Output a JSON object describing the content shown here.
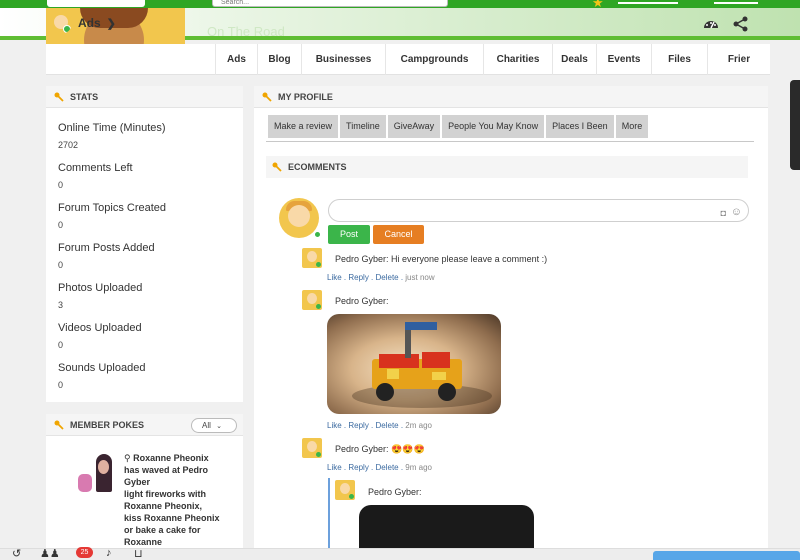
{
  "topbar": {
    "search_placeholder": "Search..."
  },
  "cover": {
    "title": "On The Road"
  },
  "ads_switch": {
    "label": "Ads"
  },
  "nav": [
    {
      "label": "Ads"
    },
    {
      "label": "Blog"
    },
    {
      "label": "Businesses"
    },
    {
      "label": "Campgrounds"
    },
    {
      "label": "Charities"
    },
    {
      "label": "Deals"
    },
    {
      "label": "Events"
    },
    {
      "label": "Files"
    },
    {
      "label": "Frier"
    }
  ],
  "stats": {
    "title": "STATS",
    "items": [
      {
        "label": "Online Time (Minutes)",
        "value": "2702"
      },
      {
        "label": "Comments Left",
        "value": "0"
      },
      {
        "label": "Forum Topics Created",
        "value": "0"
      },
      {
        "label": "Forum Posts Added",
        "value": "0"
      },
      {
        "label": "Photos Uploaded",
        "value": "3"
      },
      {
        "label": "Videos Uploaded",
        "value": "0"
      },
      {
        "label": "Sounds Uploaded",
        "value": "0"
      }
    ]
  },
  "pokes": {
    "title": "MEMBER POKES",
    "filter": "All",
    "entry": {
      "actor": "Roxanne Pheonix",
      "text": "has waved at Pedro Gyber",
      "suggestion": "light fireworks with Roxanne Pheonix, kiss Roxanne Pheonix or bake a cake for Roxanne"
    }
  },
  "profile": {
    "title": "MY PROFILE",
    "tabs": [
      "Make a review",
      "Timeline",
      "GiveAway",
      "People You May Know",
      "Places I Been",
      "More"
    ]
  },
  "ecomments": {
    "title": "ECOMMENTS",
    "post_label": "Post",
    "cancel_label": "Cancel",
    "comments": [
      {
        "text": "Pedro Gyber: Hi everyone please leave a comment :)",
        "time": "just now"
      },
      {
        "text": "Pedro Gyber:",
        "time": "2m ago"
      },
      {
        "text": "Pedro Gyber: 😍😍😍",
        "time": "9m ago"
      },
      {
        "text": "Pedro Gyber:"
      }
    ],
    "actions": {
      "like": "Like",
      "reply": "Reply",
      "delete": "Delete"
    }
  },
  "bottombar": {
    "notif_count": "25"
  },
  "colors": {
    "brand_green": "#2fa624",
    "post_button": "#3bb54a",
    "cancel_button": "#e67e22",
    "link_blue": "#3b6aa0"
  }
}
